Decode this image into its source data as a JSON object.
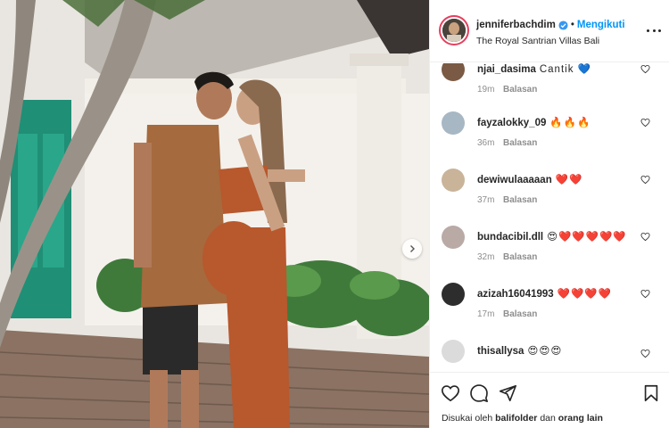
{
  "post": {
    "username": "jenniferbachdim",
    "separator": "•",
    "follow_label": "Mengikuti",
    "location": "The Royal Santrian Villas Bali"
  },
  "comments": [
    {
      "username": "njai_dasima",
      "text": "Cantik 💙",
      "time": "19m",
      "reply": "Balasan",
      "avatar_color": "#7a5a44"
    },
    {
      "username": "fayzalokky_09",
      "text": "🔥🔥🔥",
      "time": "36m",
      "reply": "Balasan",
      "avatar_color": "#a7b7c4"
    },
    {
      "username": "dewiwulaaaaan",
      "text": "❤️❤️",
      "time": "37m",
      "reply": "Balasan",
      "avatar_color": "#c9b49a"
    },
    {
      "username": "bundacibil.dll",
      "text": "😍❤️❤️❤️❤️❤️",
      "time": "32m",
      "reply": "Balasan",
      "avatar_color": "#b9aaa6"
    },
    {
      "username": "azizah16041993",
      "text": "❤️❤️❤️❤️",
      "time": "17m",
      "reply": "Balasan",
      "avatar_color": "#2d2d2d"
    },
    {
      "username": "thisallysa",
      "text": "😍😍😍",
      "time": "",
      "reply": "",
      "avatar_color": "#dbdbdb"
    }
  ],
  "likes": {
    "prefix": "Disukai oleh",
    "user": "balifolder",
    "conjunction": "dan",
    "others": "orang lain"
  },
  "colors": {
    "accent_blue": "#0095f6",
    "text": "#262626",
    "muted": "#8e8e8e"
  },
  "icons": {
    "like": "heart-outline-icon",
    "comment": "speech-bubble-icon",
    "share": "paper-plane-icon",
    "save": "bookmark-icon",
    "more": "three-dots-icon",
    "verified": "verified-badge-icon",
    "carousel_next": "chevron-right-icon"
  }
}
